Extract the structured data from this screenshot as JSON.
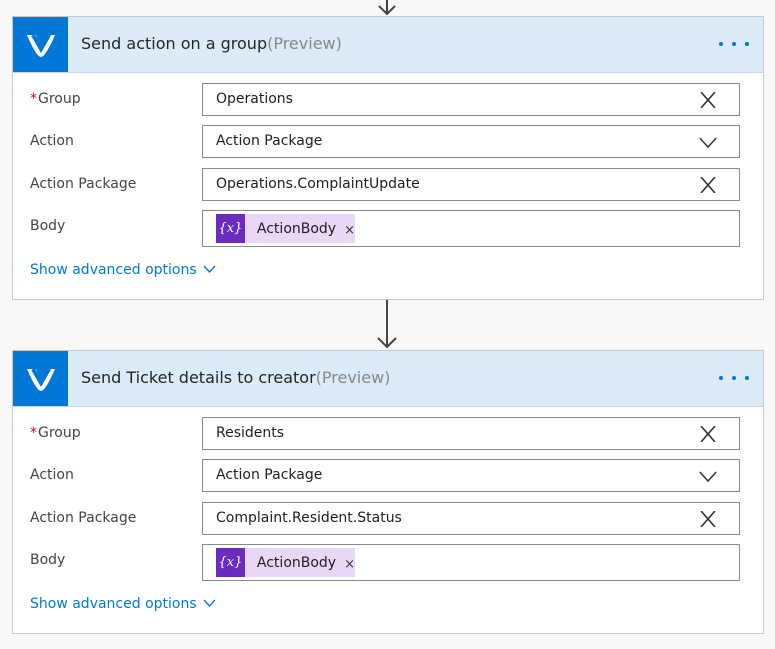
{
  "cards": [
    {
      "title": "Send action on a group",
      "preview": "(Preview)",
      "fields": {
        "group": {
          "label": "Group",
          "required_mark": "*",
          "value": "Operations"
        },
        "action": {
          "label": "Action",
          "value": "Action Package"
        },
        "action_package": {
          "label": "Action Package",
          "value": "Operations.ComplaintUpdate"
        },
        "body": {
          "label": "Body",
          "token_icon": "{x}",
          "token_label": "ActionBody",
          "token_remove": "×"
        }
      },
      "advanced_link": "Show advanced options"
    },
    {
      "title": "Send Ticket details to creator",
      "preview": "(Preview)",
      "fields": {
        "group": {
          "label": "Group",
          "required_mark": "*",
          "value": "Residents"
        },
        "action": {
          "label": "Action",
          "value": "Action Package"
        },
        "action_package": {
          "label": "Action Package",
          "value": "Complaint.Resident.Status"
        },
        "body": {
          "label": "Body",
          "token_icon": "{x}",
          "token_label": "ActionBody",
          "token_remove": "×"
        }
      },
      "advanced_link": "Show advanced options"
    }
  ],
  "icons": {
    "connector": "kaizala-check-icon",
    "more": "more-dots-icon",
    "clear": "close-icon",
    "dropdown": "chevron-down-icon",
    "flow_arrow": "arrow-down-icon"
  },
  "colors": {
    "header_bg": "#dcebf8",
    "brand": "#0078d7",
    "token_bg": "#e8d8f5",
    "token_icon_bg": "#6a2bbf",
    "required": "#d0021b"
  }
}
